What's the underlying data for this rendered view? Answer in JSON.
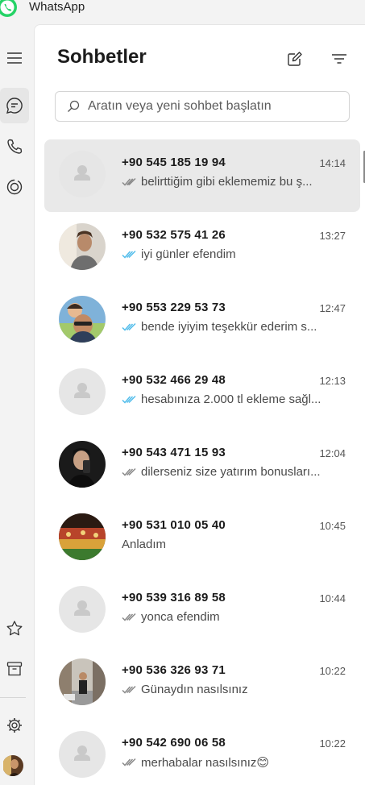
{
  "app": {
    "title": "WhatsApp"
  },
  "panel": {
    "title": "Sohbetler",
    "search_placeholder": "Aratın veya yeni sohbet başlatın"
  },
  "colors": {
    "read_tick": "#53bdeb",
    "delivered_tick": "#8a8a8a",
    "brand": "#25d366"
  },
  "chats": [
    {
      "name": "+90 545 185 19 94",
      "time": "14:14",
      "preview": "belirttiğim gibi eklememiz bu ş...",
      "tick": "delivered",
      "avatar": "default",
      "selected": true
    },
    {
      "name": "+90 532 575 41 26",
      "time": "13:27",
      "preview": "iyi günler efendim",
      "tick": "read",
      "avatar": "photo",
      "selected": false
    },
    {
      "name": "+90 553 229 53 73",
      "time": "12:47",
      "preview": "bende iyiyim teşekkür ederim s...",
      "tick": "read",
      "avatar": "photo",
      "selected": false
    },
    {
      "name": "+90 532 466 29 48",
      "time": "12:13",
      "preview": "hesabınıza 2.000 tl ekleme sağl...",
      "tick": "read",
      "avatar": "default",
      "selected": false
    },
    {
      "name": "+90 543 471 15 93",
      "time": "12:04",
      "preview": "dilerseniz size yatırım bonusları...",
      "tick": "delivered",
      "avatar": "photo",
      "selected": false
    },
    {
      "name": "+90 531 010 05 40",
      "time": "10:45",
      "preview": "Anladım",
      "tick": "none",
      "avatar": "photo",
      "selected": false
    },
    {
      "name": "+90 539 316 89 58",
      "time": "10:44",
      "preview": "yonca efendim",
      "tick": "delivered",
      "avatar": "default",
      "selected": false
    },
    {
      "name": "+90 536 326 93 71",
      "time": "10:22",
      "preview": "Günaydın nasılsınız",
      "tick": "delivered",
      "avatar": "photo",
      "selected": false
    },
    {
      "name": "+90 542 690 06 58",
      "time": "10:22",
      "preview": "merhabalar nasılsınız😊",
      "tick": "delivered",
      "avatar": "default",
      "selected": false
    }
  ]
}
